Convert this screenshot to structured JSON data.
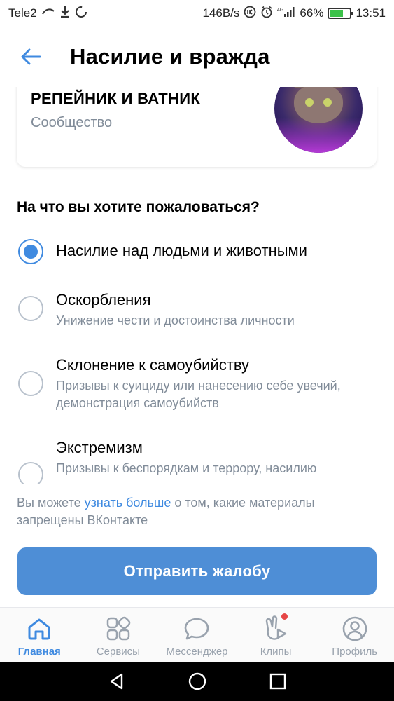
{
  "status_bar": {
    "carrier": "Tele2",
    "speed": "146B/s",
    "battery": "66%",
    "battery_level": 0.66,
    "time": "13:51"
  },
  "header": {
    "title": "Насилие и вражда"
  },
  "community": {
    "name": "РЕПЕЙНИК И ВАТНИК",
    "type": "Сообщество"
  },
  "question": "На что вы хотите пожаловаться?",
  "options": [
    {
      "label": "Насилие над людьми и животными",
      "description": "",
      "checked": true
    },
    {
      "label": "Оскорбления",
      "description": "Унижение чести и достоинства личности",
      "checked": false
    },
    {
      "label": "Склонение к самоубийству",
      "description": "Призывы к суициду или нанесению себе увечий, демонстрация самоубийств",
      "checked": false
    },
    {
      "label": "Экстремизм",
      "description": "Призывы к беспорядкам и террору, насилию",
      "checked": false
    }
  ],
  "info": {
    "before": "Вы можете ",
    "link": "узнать больше",
    "after": " о том, какие материалы запрещены ВКонтакте"
  },
  "submit_label": "Отправить жалобу",
  "tabs": [
    {
      "label": "Главная",
      "icon": "home-icon",
      "active": true
    },
    {
      "label": "Сервисы",
      "icon": "services-icon",
      "active": false
    },
    {
      "label": "Мессенджер",
      "icon": "messenger-icon",
      "active": false
    },
    {
      "label": "Клипы",
      "icon": "clips-icon",
      "active": false,
      "badge": true
    },
    {
      "label": "Профиль",
      "icon": "profile-icon",
      "active": false
    }
  ],
  "colors": {
    "accent": "#3f8ae0",
    "button": "#4e8ed6",
    "secondary_text": "#818c99",
    "badge": "#e64646"
  }
}
